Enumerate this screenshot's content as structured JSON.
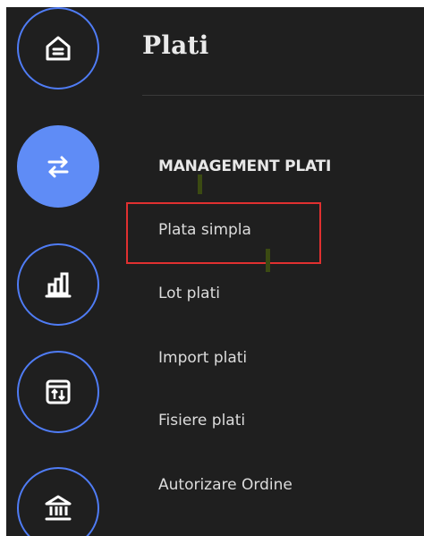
{
  "window": {
    "title": "Plati"
  },
  "rail": {
    "buttons": [
      {
        "icon": "home-icon",
        "active": false
      },
      {
        "icon": "transfer-arrows-icon",
        "active": true
      },
      {
        "icon": "bar-chart-icon",
        "active": false
      },
      {
        "icon": "import-export-icon",
        "active": false
      },
      {
        "icon": "bank-icon",
        "active": false
      }
    ]
  },
  "menu": {
    "heading": "MANAGEMENT PLATI",
    "items": [
      {
        "label": "Plata simpla",
        "highlighted": true
      },
      {
        "label": "Lot plati"
      },
      {
        "label": "Import plati"
      },
      {
        "label": "Fisiere plati"
      },
      {
        "label": "Autorizare Ordine"
      }
    ]
  },
  "colors": {
    "background": "#1f1f1f",
    "accent": "#5f8cf6",
    "ring": "#4f7cf5",
    "text": "#dcdcdc",
    "highlight": "#e03030"
  }
}
